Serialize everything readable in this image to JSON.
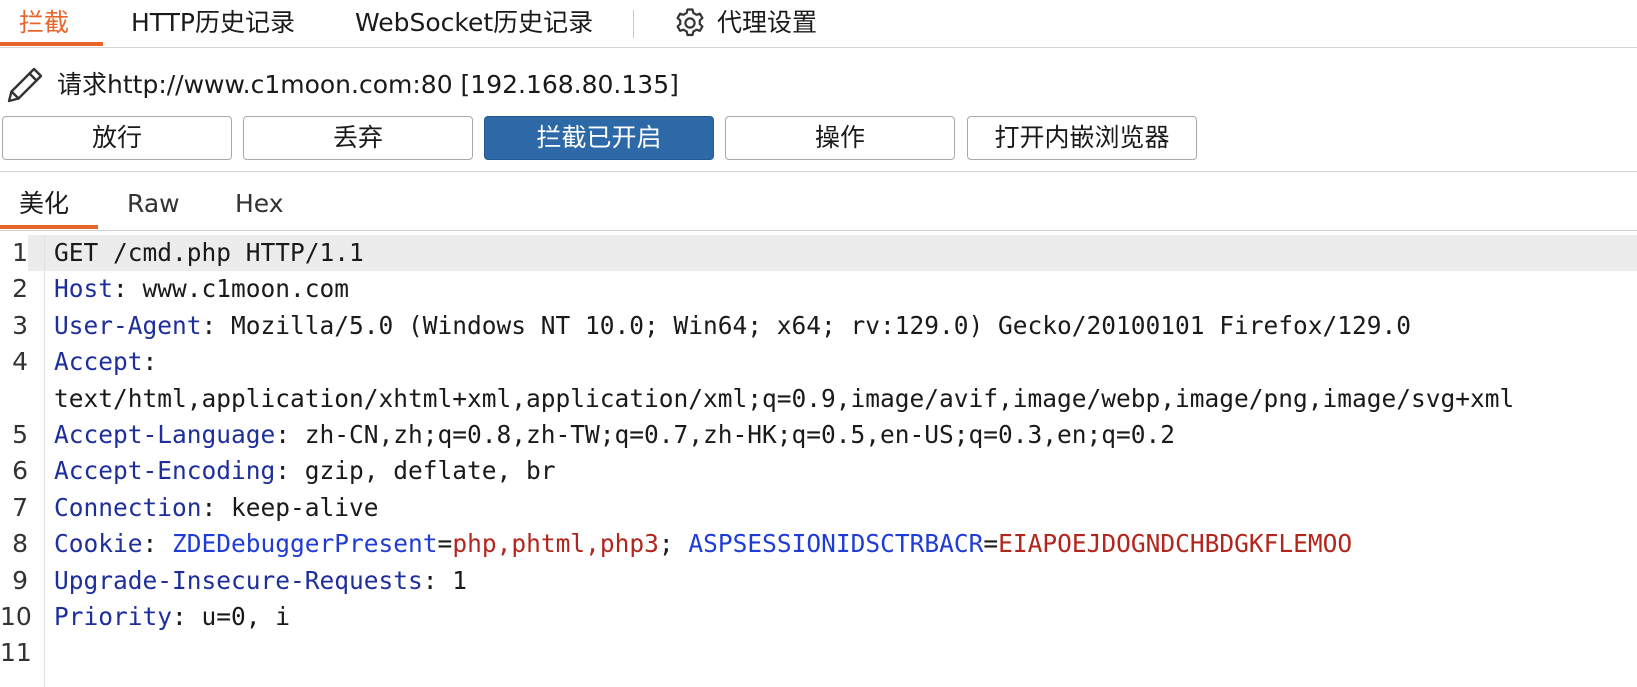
{
  "top_tabs": [
    {
      "label": "拦截",
      "active": true
    },
    {
      "label": "HTTP历史记录",
      "active": false
    },
    {
      "label": "WebSocket历史记录",
      "active": false
    },
    {
      "label": "代理设置",
      "active": false,
      "icon": "gear-icon"
    }
  ],
  "request_line": {
    "icon": "pencil-icon",
    "text": "请求http://www.c1moon.com:80  [192.168.80.135]"
  },
  "buttons": {
    "forward": "放行",
    "drop": "丢弃",
    "intercept": "拦截已开启",
    "action": "操作",
    "browser": "打开内嵌浏览器"
  },
  "sub_tabs": [
    {
      "label": "美化",
      "active": true
    },
    {
      "label": "Raw",
      "active": false
    },
    {
      "label": "Hex",
      "active": false
    }
  ],
  "colors": {
    "accent": "#e8662c",
    "primary_button": "#2c69a6",
    "header_name": "#1e2f9c",
    "cookie_name": "#1f3cd6",
    "cookie_value": "#b3261e"
  },
  "editor": {
    "lines": [
      {
        "num": "1",
        "text": "GET /cmd.php HTTP/1.1"
      },
      {
        "num": "2",
        "name": "Host",
        "value": ": www.c1moon.com"
      },
      {
        "num": "3",
        "name": "User-Agent",
        "value": ": Mozilla/5.0 (Windows NT 10.0; Win64; x64; rv:129.0) Gecko/20100101 Firefox/129.0"
      },
      {
        "num": "4",
        "name": "Accept",
        "value": ":"
      },
      {
        "num": "",
        "text": "text/html,application/xhtml+xml,application/xml;q=0.9,image/avif,image/webp,image/png,image/svg+xml"
      },
      {
        "num": "5",
        "name": "Accept-Language",
        "value": ": zh-CN,zh;q=0.8,zh-TW;q=0.7,zh-HK;q=0.5,en-US;q=0.3,en;q=0.2"
      },
      {
        "num": "6",
        "name": "Accept-Encoding",
        "value": ": gzip, deflate, br"
      },
      {
        "num": "7",
        "name": "Connection",
        "value": ": keep-alive"
      },
      {
        "num": "8",
        "name": "Cookie",
        "value": ": ",
        "cookies": [
          {
            "name": "ZDEDebuggerPresent",
            "eq": "=",
            "value": "php,phtml,php3",
            "sep": "; "
          },
          {
            "name": "ASPSESSIONIDSCTRBACR",
            "eq": "=",
            "value": "EIAPOEJDOGNDCHBDGKFLEMOO",
            "sep": ""
          }
        ]
      },
      {
        "num": "9",
        "name": "Upgrade-Insecure-Requests",
        "value": ": 1"
      },
      {
        "num": "10",
        "name": "Priority",
        "value": ": u=0, i"
      },
      {
        "num": "11",
        "text": ""
      }
    ]
  }
}
